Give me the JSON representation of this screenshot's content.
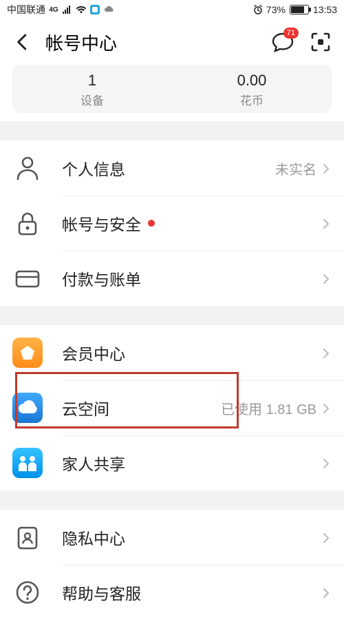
{
  "statusbar": {
    "carrier": "中国联通",
    "network_badge": "4G",
    "battery_pct": "73%",
    "time": "13:53"
  },
  "header": {
    "title": "帐号中心",
    "chat_badge": "71"
  },
  "stats": {
    "devices_num": "1",
    "devices_label": "设备",
    "coins_num": "0.00",
    "coins_label": "花币"
  },
  "rows": {
    "personal_info": {
      "label": "个人信息",
      "right": "未实名"
    },
    "account_security": {
      "label": "帐号与安全"
    },
    "payment_bills": {
      "label": "付款与账单"
    },
    "member_center": {
      "label": "会员中心"
    },
    "cloud_space": {
      "label": "云空间",
      "right": "已使用 1.81 GB"
    },
    "family_share": {
      "label": "家人共享"
    },
    "privacy_center": {
      "label": "隐私中心"
    },
    "help_service": {
      "label": "帮助与客服"
    }
  }
}
